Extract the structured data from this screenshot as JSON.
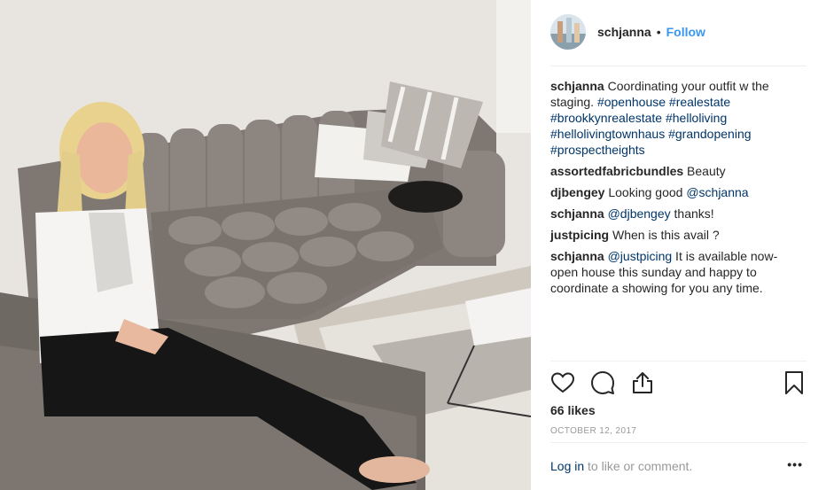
{
  "post": {
    "username": "schjanna",
    "dot": "•",
    "follow_label": "Follow",
    "likes": "66 likes",
    "date": "OCTOBER 12, 2017",
    "login_label": "Log in",
    "login_suffix": " to like or comment.",
    "more_label": "•••"
  },
  "comments": [
    {
      "user": "schjanna",
      "parts": [
        {
          "t": "text",
          "v": "Coordinating your outfit w the staging. "
        },
        {
          "t": "tag",
          "v": "#openhouse"
        },
        {
          "t": "text",
          "v": " "
        },
        {
          "t": "tag",
          "v": "#realestate"
        },
        {
          "t": "text",
          "v": " "
        },
        {
          "t": "tag",
          "v": "#brookkynrealestate"
        },
        {
          "t": "text",
          "v": " "
        },
        {
          "t": "tag",
          "v": "#helloliving"
        },
        {
          "t": "text",
          "v": " "
        },
        {
          "t": "tag",
          "v": "#hellolivingtownhaus"
        },
        {
          "t": "text",
          "v": " "
        },
        {
          "t": "tag",
          "v": "#grandopening"
        },
        {
          "t": "text",
          "v": " "
        },
        {
          "t": "tag",
          "v": "#prospectheights"
        }
      ]
    },
    {
      "user": "assortedfabricbundles",
      "parts": [
        {
          "t": "text",
          "v": "Beauty"
        }
      ]
    },
    {
      "user": "djbengey",
      "parts": [
        {
          "t": "text",
          "v": "Looking good "
        },
        {
          "t": "tag",
          "v": "@schjanna"
        }
      ]
    },
    {
      "user": "schjanna",
      "parts": [
        {
          "t": "tag",
          "v": "@djbengey"
        },
        {
          "t": "text",
          "v": " thanks!"
        }
      ]
    },
    {
      "user": "justpicing",
      "parts": [
        {
          "t": "text",
          "v": "When is this avail ?"
        }
      ]
    },
    {
      "user": "schjanna",
      "parts": [
        {
          "t": "tag",
          "v": "@justpicing"
        },
        {
          "t": "text",
          "v": " It is available now- open house this sunday and happy to coordinate a showing for you any time."
        }
      ]
    }
  ],
  "icons": {
    "like": "heart-icon",
    "comment": "comment-bubble-icon",
    "share": "share-upload-icon",
    "save": "bookmark-icon"
  },
  "colors": {
    "link": "#3897f0",
    "tag": "#003569",
    "muted": "#999999",
    "border": "#efefef"
  }
}
